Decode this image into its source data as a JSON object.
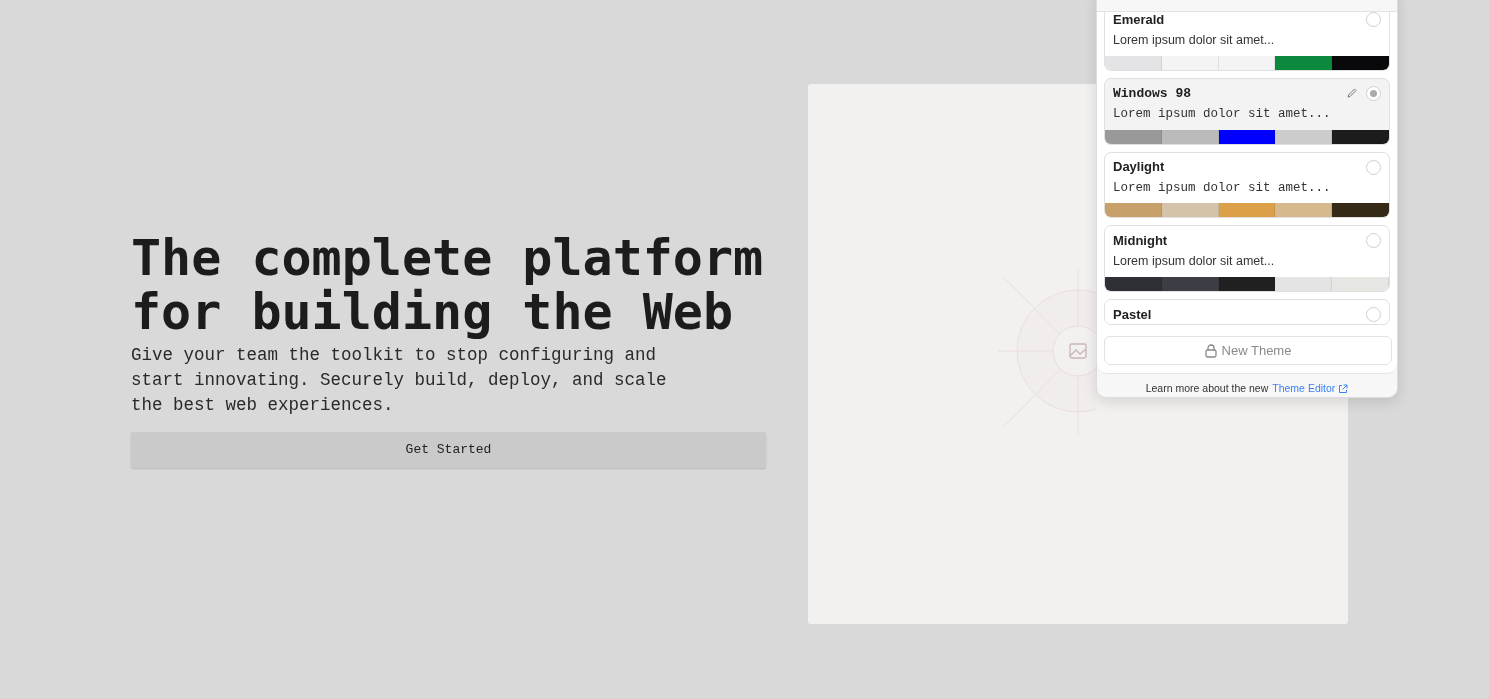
{
  "hero": {
    "heading": "The complete platform for building the Web",
    "subtext": "Give your team the toolkit to stop configuring and start innovating. Securely build, deploy, and scale the best web experiences.",
    "button": "Get Started"
  },
  "theme_panel": {
    "themes": [
      {
        "name": "Emerald",
        "preview": "Lorem ipsum dolor sit amet...",
        "mono_title": false,
        "mono_preview": false,
        "selected": false,
        "editable": false,
        "swatches": [
          {
            "color": "#e4e4e7"
          },
          {
            "color": "#f4f4f5"
          },
          {
            "color": "#f4f4f5"
          },
          {
            "color": "#0b8a3e"
          },
          {
            "color": "#09090b"
          }
        ]
      },
      {
        "name": "Windows 98",
        "preview": "Lorem ipsum dolor sit amet...",
        "mono_title": true,
        "mono_preview": true,
        "selected": true,
        "editable": true,
        "swatches": [
          {
            "color": "#999999"
          },
          {
            "color": "#bbbbbb"
          },
          {
            "color": "#0000ff"
          },
          {
            "color": "#cccccc"
          },
          {
            "color": "#1c1c1c"
          }
        ]
      },
      {
        "name": "Daylight",
        "preview": "Lorem ipsum dolor sit amet...",
        "mono_title": false,
        "mono_preview": true,
        "selected": false,
        "editable": false,
        "swatches": [
          {
            "color": "#c8a16a"
          },
          {
            "color": "#d5c3a9"
          },
          {
            "color": "#dba049"
          },
          {
            "color": "#d7b98e"
          },
          {
            "color": "#352a15"
          }
        ]
      },
      {
        "name": "Midnight",
        "preview": "Lorem ipsum dolor sit amet...",
        "mono_title": false,
        "mono_preview": false,
        "selected": false,
        "editable": false,
        "swatches": [
          {
            "color": "#2f2f36"
          },
          {
            "color": "#3d3d45"
          },
          {
            "color": "#202020"
          },
          {
            "color": "#e4e4e4"
          },
          {
            "color": "#e6e6e3"
          }
        ]
      },
      {
        "name": "Pastel",
        "mono_title": false,
        "selected": false,
        "editable": false
      }
    ],
    "new_button": {
      "label": "New Theme",
      "locked": true
    },
    "footer": {
      "text": "Learn more about the new",
      "link": "Theme Editor"
    }
  }
}
